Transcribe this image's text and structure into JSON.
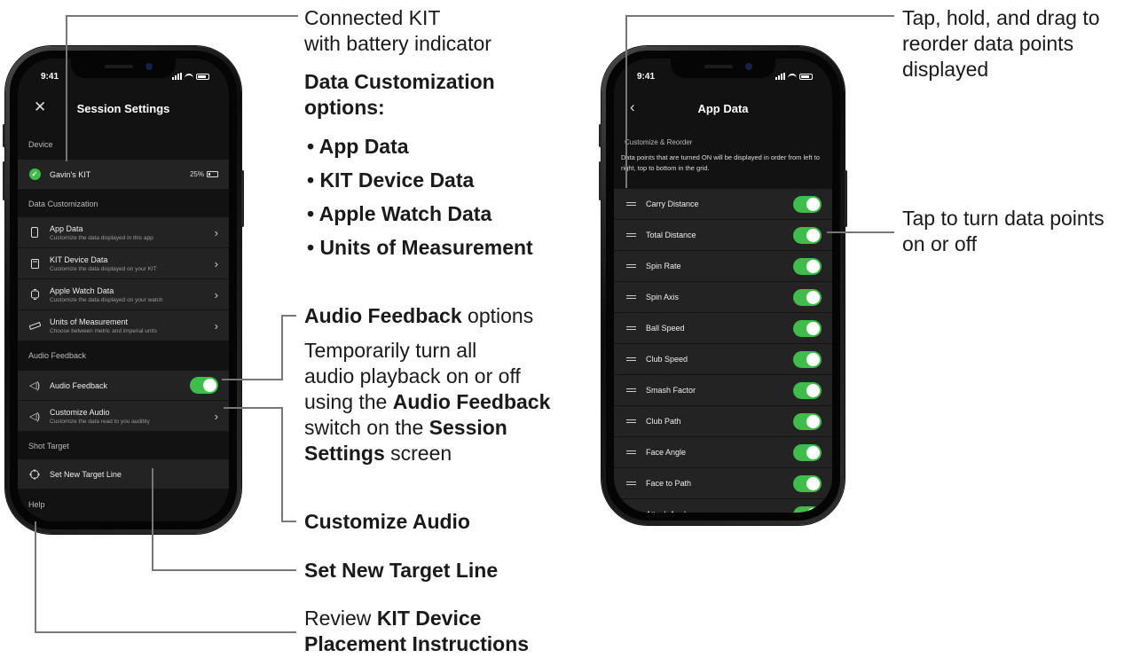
{
  "left_phone": {
    "status_time": "9:41",
    "nav_close_icon": "close-icon",
    "title": "Session Settings",
    "device_header": "Device",
    "device_name": "Gavin's KIT",
    "battery_pct": "25%",
    "data_header": "Data Customization",
    "data_items": [
      {
        "title": "App Data",
        "subtitle": "Customize the data displayed in this app",
        "icon": "phone-icon"
      },
      {
        "title": "KIT Device Data",
        "subtitle": "Customize the data displayed on your KIT",
        "icon": "kit-device-icon"
      },
      {
        "title": "Apple Watch Data",
        "subtitle": "Customize the data displayed on your watch",
        "icon": "watch-icon"
      },
      {
        "title": "Units of Measurement",
        "subtitle": "Choose between metric and imperial units",
        "icon": "ruler-icon"
      }
    ],
    "audio_header": "Audio Feedback",
    "audio_feedback_label": "Audio Feedback",
    "audio_feedback_on": true,
    "customize_audio_title": "Customize Audio",
    "customize_audio_sub": "Customize the data read to you audibly",
    "shot_header": "Shot Target",
    "target_label": "Set New Target Line",
    "help_header": "Help"
  },
  "right_phone": {
    "status_time": "9:41",
    "title": "App Data",
    "section_header": "Customize & Reorder",
    "description": "Data points that are turned ON will be displayed in order from left to right, top to bottom in the grid.",
    "items": [
      {
        "label": "Carry Distance",
        "on": true
      },
      {
        "label": "Total Distance",
        "on": true
      },
      {
        "label": "Spin Rate",
        "on": true
      },
      {
        "label": "Spin Axis",
        "on": true
      },
      {
        "label": "Ball Speed",
        "on": true
      },
      {
        "label": "Club Speed",
        "on": true
      },
      {
        "label": "Smash Factor",
        "on": true
      },
      {
        "label": "Club Path",
        "on": true
      },
      {
        "label": "Face Angle",
        "on": true
      },
      {
        "label": "Face to Path",
        "on": true
      },
      {
        "label": "Attack Angle",
        "on": true
      }
    ]
  },
  "annotations": {
    "connected_kit_l1": "Connected KIT",
    "connected_kit_l2": "with battery indicator",
    "data_custom_l1": "Data Customization",
    "data_custom_l2": "options:",
    "bullets": [
      "• App Data",
      "• KIT Device Data",
      "• Apple Watch Data",
      "• Units of Measurement"
    ],
    "audio_fb_bold": "Audio Feedback",
    "audio_fb_rest": " options",
    "temp_l1": "Temporarily turn all",
    "temp_l2": "audio playback on or off",
    "temp_l3_pre": "using the ",
    "temp_l3_bold": "Audio Feedback",
    "temp_l4_pre": "switch on the ",
    "temp_l4_bold": "Session",
    "temp_l5_bold": "Settings",
    "temp_l5_rest": " screen",
    "customize_audio": "Customize Audio",
    "target_line": "Set New Target Line",
    "review_pre": "Review ",
    "review_bold_1": "KIT Device",
    "review_bold_2": "Placement Instructions",
    "reorder_l1": "Tap, hold, and drag to",
    "reorder_l2": "reorder data points",
    "reorder_l3": "displayed",
    "toggle_l1": "Tap to turn data points",
    "toggle_l2": "on or off"
  }
}
